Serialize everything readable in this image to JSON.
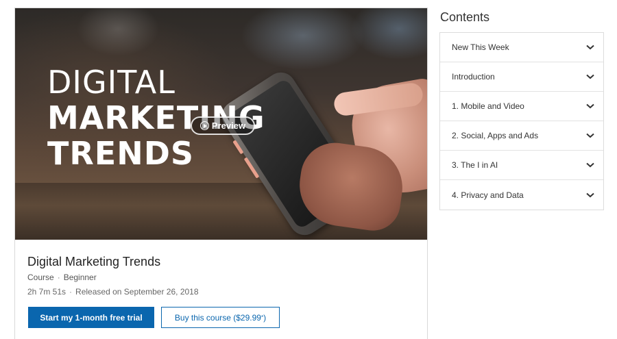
{
  "hero": {
    "title_line1": "DIGITAL",
    "title_line2": "MARKETING",
    "title_line3": "TRENDS",
    "preview_label": "Preview"
  },
  "course": {
    "title": "Digital Marketing Trends",
    "type": "Course",
    "level": "Beginner",
    "duration": "2h 7m 51s",
    "released": "Released on September 26, 2018"
  },
  "actions": {
    "trial_label": "Start my 1-month free trial",
    "buy_label_prefix": "Buy this course ($29.99",
    "buy_label_sup": "*",
    "buy_label_suffix": ")"
  },
  "contents": {
    "heading": "Contents",
    "items": [
      {
        "label": "New This Week"
      },
      {
        "label": "Introduction"
      },
      {
        "label": "1. Mobile and Video"
      },
      {
        "label": "2. Social, Apps and Ads"
      },
      {
        "label": "3. The I in AI"
      },
      {
        "label": "4. Privacy and Data"
      }
    ]
  },
  "colors": {
    "accent": "#0a66ae",
    "border": "#d9d9d9"
  },
  "icons": {
    "preview": "play-circle-icon",
    "accordion": "chevron-down-icon"
  }
}
